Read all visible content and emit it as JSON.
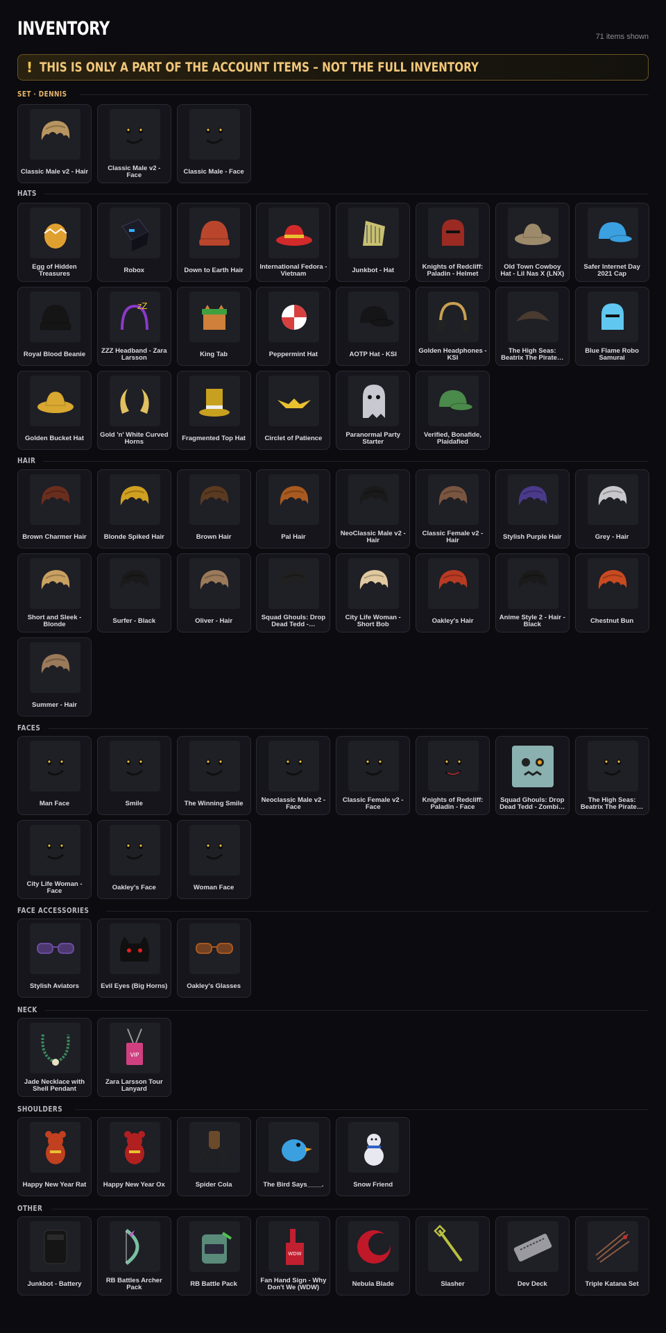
{
  "header": {
    "title": "INVENTORY",
    "count": "71 items shown"
  },
  "warning": {
    "mark": "!",
    "text": "THIS IS ONLY A PART OF THE ACCOUNT ITEMS – NOT THE FULL INVENTORY"
  },
  "sections": [
    {
      "label": "SET · DENNIS",
      "accent": "gold",
      "items": [
        {
          "name": "Classic Male v2 - Hair",
          "icon": "hair-icon",
          "color": "#b8955f"
        },
        {
          "name": "Classic Male v2 - Face",
          "icon": "face-icon",
          "color": "#111111"
        },
        {
          "name": "Classic Male - Face",
          "icon": "face-icon",
          "color": "#111111"
        }
      ]
    },
    {
      "label": "HATS",
      "items": [
        {
          "name": "Egg of Hidden Treasures",
          "icon": "egg-icon",
          "color": "#e0a030"
        },
        {
          "name": "Robox",
          "icon": "cube-icon",
          "color": "#1c1c28"
        },
        {
          "name": "Down to Earth Hair",
          "icon": "beanie-icon",
          "color": "#b9462c"
        },
        {
          "name": "International Fedora - Vietnam",
          "icon": "fedora-icon",
          "color": "#d22a2a"
        },
        {
          "name": "Junkbot - Hat",
          "icon": "hat-icon",
          "color": "#c8c070"
        },
        {
          "name": "Knights of Redcliff: Paladin - Helmet",
          "icon": "helmet-icon",
          "color": "#9a2a22"
        },
        {
          "name": "Old Town Cowboy Hat - Lil Nas X (LNX)",
          "icon": "cowboy-hat-icon",
          "color": "#9c8a6a"
        },
        {
          "name": "Safer Internet Day 2021 Cap",
          "icon": "cap-icon",
          "color": "#3aa0e0"
        },
        {
          "name": "Royal Blood Beanie",
          "icon": "beanie-icon",
          "color": "#151515"
        },
        {
          "name": "ZZZ Headband - Zara Larsson",
          "icon": "headband-icon",
          "color": "#8a3ac8"
        },
        {
          "name": "King Tab",
          "icon": "cat-icon",
          "color": "#d0803a"
        },
        {
          "name": "Peppermint Hat",
          "icon": "peppermint-icon",
          "color": "#d84040"
        },
        {
          "name": "AOTP Hat - KSI",
          "icon": "cap-icon",
          "color": "#151518"
        },
        {
          "name": "Golden Headphones - KSI",
          "icon": "headphones-icon",
          "color": "#c8a050"
        },
        {
          "name": "The High Seas: Beatrix The Pirate…",
          "icon": "pirate-hat-icon",
          "color": "#4a3a30"
        },
        {
          "name": "Blue Flame Robo Samurai",
          "icon": "samurai-icon",
          "color": "#60c8f0"
        },
        {
          "name": "Golden Bucket Hat",
          "icon": "bucket-hat-icon",
          "color": "#d8a830"
        },
        {
          "name": "Gold 'n' White Curved Horns",
          "icon": "horns-icon",
          "color": "#e0c060"
        },
        {
          "name": "Fragmented Top Hat",
          "icon": "top-hat-icon",
          "color": "#c8a020"
        },
        {
          "name": "Circlet of Patience",
          "icon": "circlet-icon",
          "color": "#e8c030"
        },
        {
          "name": "Paranormal Party Starter",
          "icon": "ghost-icon",
          "color": "#c8c8d0"
        },
        {
          "name": "Verified, Bonafide, Plaidafied",
          "icon": "cap-icon",
          "color": "#4a8a4a"
        }
      ]
    },
    {
      "label": "HAIR",
      "items": [
        {
          "name": "Brown Charmer Hair",
          "icon": "hair-icon",
          "color": "#6a2e1e"
        },
        {
          "name": "Blonde Spiked Hair",
          "icon": "hair-icon",
          "color": "#d0a020"
        },
        {
          "name": "Brown Hair",
          "icon": "hair-icon",
          "color": "#5a3a20"
        },
        {
          "name": "Pal Hair",
          "icon": "hair-icon",
          "color": "#a85a20"
        },
        {
          "name": "NeoClassic Male v2 - Hair",
          "icon": "hair-icon",
          "color": "#1a1a1a"
        },
        {
          "name": "Classic Female v2 - Hair",
          "icon": "hair-icon",
          "color": "#7a5540"
        },
        {
          "name": "Stylish Purple Hair",
          "icon": "hair-icon",
          "color": "#4a3a8a"
        },
        {
          "name": "Grey - Hair",
          "icon": "hair-icon",
          "color": "#c8c8cc"
        },
        {
          "name": "Short and Sleek - Blonde",
          "icon": "hair-icon",
          "color": "#c8a060"
        },
        {
          "name": "Surfer - Black",
          "icon": "hair-icon",
          "color": "#1a1a1a"
        },
        {
          "name": "Oliver - Hair",
          "icon": "hair-icon",
          "color": "#9a7a5a"
        },
        {
          "name": "Squad Ghouls: Drop Dead Tedd -…",
          "icon": "hair-icon",
          "color": "#202020"
        },
        {
          "name": "City Life Woman - Short Bob",
          "icon": "hair-icon",
          "color": "#e0c8a0"
        },
        {
          "name": "Oakley's Hair",
          "icon": "hair-icon",
          "color": "#b83a22"
        },
        {
          "name": "Anime Style 2 - Hair - Black",
          "icon": "hair-icon",
          "color": "#1a1a1a"
        },
        {
          "name": "Chestnut Bun",
          "icon": "hair-icon",
          "color": "#c84a20"
        },
        {
          "name": "Summer - Hair",
          "icon": "hair-icon",
          "color": "#9a7a5a"
        }
      ]
    },
    {
      "label": "FACES",
      "items": [
        {
          "name": "Man Face",
          "icon": "face-icon",
          "color": "#111111"
        },
        {
          "name": "Smile",
          "icon": "face-icon",
          "color": "#111111"
        },
        {
          "name": "The Winning Smile",
          "icon": "face-icon",
          "color": "#111111"
        },
        {
          "name": "Neoclassic Male v2 - Face",
          "icon": "face-icon",
          "color": "#111111"
        },
        {
          "name": "Classic Female v2 - Face",
          "icon": "face-icon",
          "color": "#111111"
        },
        {
          "name": "Knights of Redcliff: Paladin - Face",
          "icon": "face-icon",
          "color": "#c03030"
        },
        {
          "name": "Squad Ghouls: Drop Dead Tedd - Zombi…",
          "icon": "zombie-face-icon",
          "color": "#8ab0b0"
        },
        {
          "name": "The High Seas: Beatrix The Pirate…",
          "icon": "face-icon",
          "color": "#111111"
        },
        {
          "name": "City Life Woman - Face",
          "icon": "face-icon",
          "color": "#111111"
        },
        {
          "name": "Oakley's Face",
          "icon": "face-icon",
          "color": "#111111"
        },
        {
          "name": "Woman Face",
          "icon": "face-icon",
          "color": "#111111"
        }
      ]
    },
    {
      "label": "FACE ACCESSORIES",
      "items": [
        {
          "name": "Stylish Aviators",
          "icon": "sunglasses-icon",
          "color": "#6a4aa0"
        },
        {
          "name": "Evil Eyes (Big Horns)",
          "icon": "demon-mask-icon",
          "color": "#101010"
        },
        {
          "name": "Oakley's Glasses",
          "icon": "glasses-icon",
          "color": "#a8581e"
        }
      ]
    },
    {
      "label": "NECK",
      "items": [
        {
          "name": "Jade Necklace with Shell Pendant",
          "icon": "necklace-icon",
          "color": "#3a8a5a"
        },
        {
          "name": "Zara Larsson Tour Lanyard",
          "icon": "lanyard-icon",
          "color": "#d04080"
        }
      ]
    },
    {
      "label": "SHOULDERS",
      "items": [
        {
          "name": "Happy New Year Rat",
          "icon": "rat-icon",
          "color": "#c04020"
        },
        {
          "name": "Happy New Year Ox",
          "icon": "ox-icon",
          "color": "#b02020"
        },
        {
          "name": "Spider Cola",
          "icon": "spider-icon",
          "color": "#6a4a2a"
        },
        {
          "name": "The Bird Says____.",
          "icon": "bird-icon",
          "color": "#3aa0e0"
        },
        {
          "name": "Snow Friend",
          "icon": "snowman-icon",
          "color": "#e8e8f0"
        }
      ]
    },
    {
      "label": "OTHER",
      "items": [
        {
          "name": "Junkbot - Battery",
          "icon": "battery-icon",
          "color": "#151515"
        },
        {
          "name": "RB Battles Archer Pack",
          "icon": "bow-icon",
          "color": "#7ac0a0"
        },
        {
          "name": "RB Battle Pack",
          "icon": "backpack-icon",
          "color": "#5a8a7a"
        },
        {
          "name": "Fan Hand Sign - Why Don't We (WDW)",
          "icon": "foam-finger-icon",
          "color": "#c02030"
        },
        {
          "name": "Nebula Blade",
          "icon": "blade-icon",
          "color": "#c01828"
        },
        {
          "name": "Slasher",
          "icon": "sword-icon",
          "color": "#b8c040"
        },
        {
          "name": "Dev Deck",
          "icon": "keyboard-icon",
          "color": "#9a9aa0"
        },
        {
          "name": "Triple Katana Set",
          "icon": "katana-icon",
          "color": "#8a5a40"
        }
      ]
    }
  ]
}
